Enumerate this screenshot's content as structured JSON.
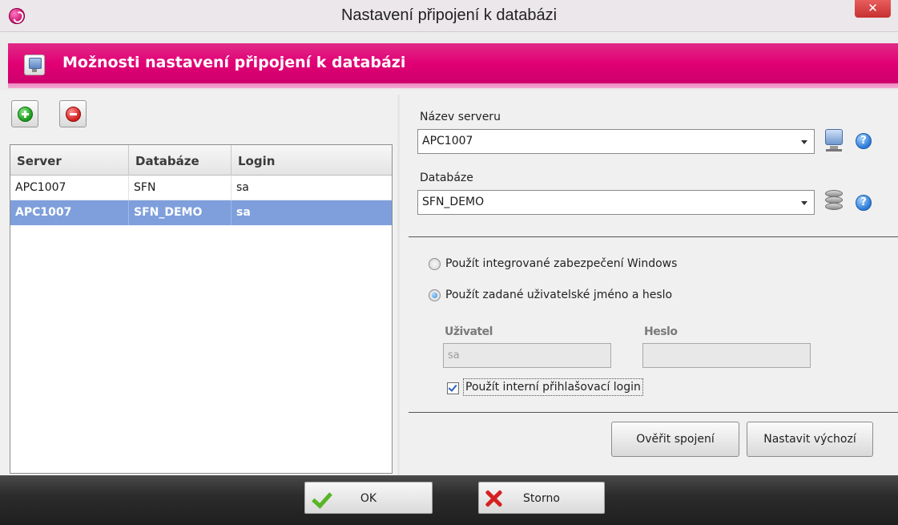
{
  "window": {
    "title": "Nastavení připojení k databázi",
    "close_glyph": "✕"
  },
  "header": {
    "title": "Možnosti nastavení připojení k databázi"
  },
  "grid": {
    "columns": [
      "Server",
      "Databáze",
      "Login"
    ],
    "rows": [
      {
        "server": "APC1007",
        "database": "SFN",
        "login": "sa",
        "selected": false
      },
      {
        "server": "APC1007",
        "database": "SFN_DEMO",
        "login": "sa",
        "selected": true
      }
    ]
  },
  "form": {
    "server_label": "Název serveru",
    "server_value": "APC1007",
    "database_label": "Databáze",
    "database_value": "SFN_DEMO",
    "help_glyph": "?",
    "auth_windows_label": "Použít integrované zabezpečení Windows",
    "auth_user_label": "Použít zadané uživatelské jméno a heslo",
    "user_label": "Uživatel",
    "user_value": "sa",
    "password_label": "Heslo",
    "password_value": "",
    "internal_login_label": "Použít interní přihlašovací login",
    "internal_login_checked": true,
    "test_button": "Ověřit spojení",
    "default_button": "Nastavit výchozí"
  },
  "footer": {
    "ok_label": "OK",
    "cancel_label": "Storno"
  },
  "colors": {
    "accent": "#e10075",
    "selection": "#7e9fdc",
    "footer": "#2c2c2c"
  }
}
